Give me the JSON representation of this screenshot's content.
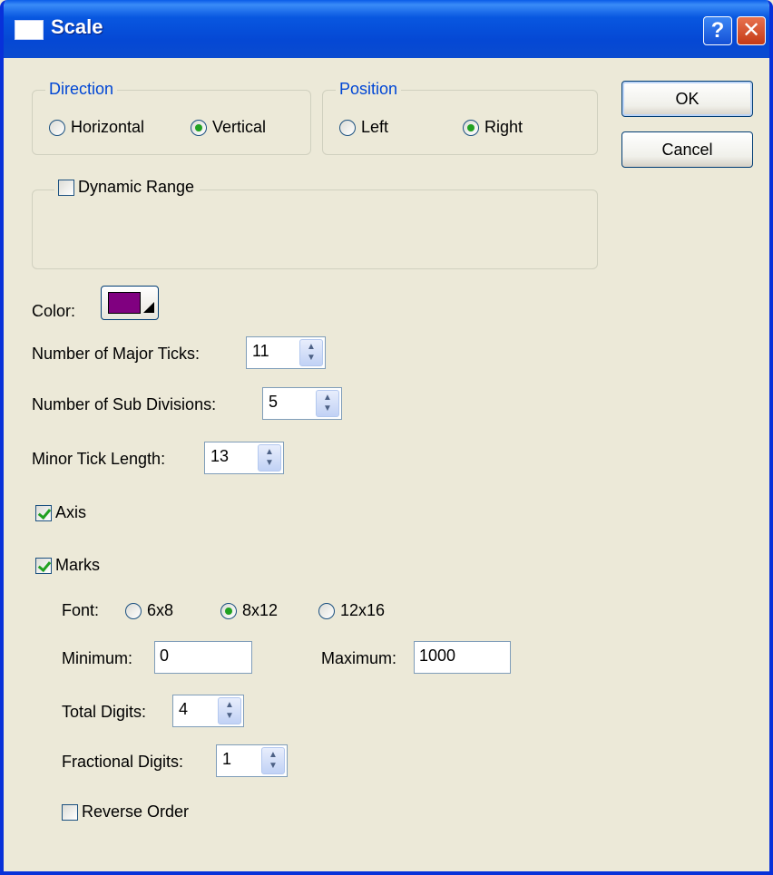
{
  "window": {
    "title": "Scale",
    "help_label": "?",
    "close_label": "✕"
  },
  "direction": {
    "legend": "Direction",
    "options": [
      {
        "label": "Horizontal",
        "selected": false
      },
      {
        "label": "Vertical",
        "selected": true
      }
    ]
  },
  "position": {
    "legend": "Position",
    "options": [
      {
        "label": "Left",
        "selected": false
      },
      {
        "label": "Right",
        "selected": true
      }
    ]
  },
  "buttons": {
    "ok": "OK",
    "cancel": "Cancel"
  },
  "dynamic_range": {
    "label": "Dynamic Range",
    "checked": false
  },
  "color": {
    "label": "Color:",
    "value": "#800080"
  },
  "major_ticks": {
    "label": "Number of Major Ticks:",
    "value": "11"
  },
  "sub_divisions": {
    "label": "Number of Sub Divisions:",
    "value": "5"
  },
  "minor_tick_length": {
    "label": "Minor Tick Length:",
    "value": "13"
  },
  "axis": {
    "label": "Axis",
    "checked": true
  },
  "marks": {
    "label": "Marks",
    "checked": true
  },
  "font": {
    "label": "Font:",
    "options": [
      {
        "label": "6x8",
        "selected": false
      },
      {
        "label": "8x12",
        "selected": true
      },
      {
        "label": "12x16",
        "selected": false
      }
    ]
  },
  "minimum": {
    "label": "Minimum:",
    "value": "0"
  },
  "maximum": {
    "label": "Maximum:",
    "value": "1000"
  },
  "total_digits": {
    "label": "Total Digits:",
    "value": "4"
  },
  "fractional_digits": {
    "label": "Fractional Digits:",
    "value": "1"
  },
  "reverse_order": {
    "label": "Reverse Order",
    "checked": false
  },
  "icons": {
    "spin_up": "▲",
    "spin_down": "▼"
  }
}
